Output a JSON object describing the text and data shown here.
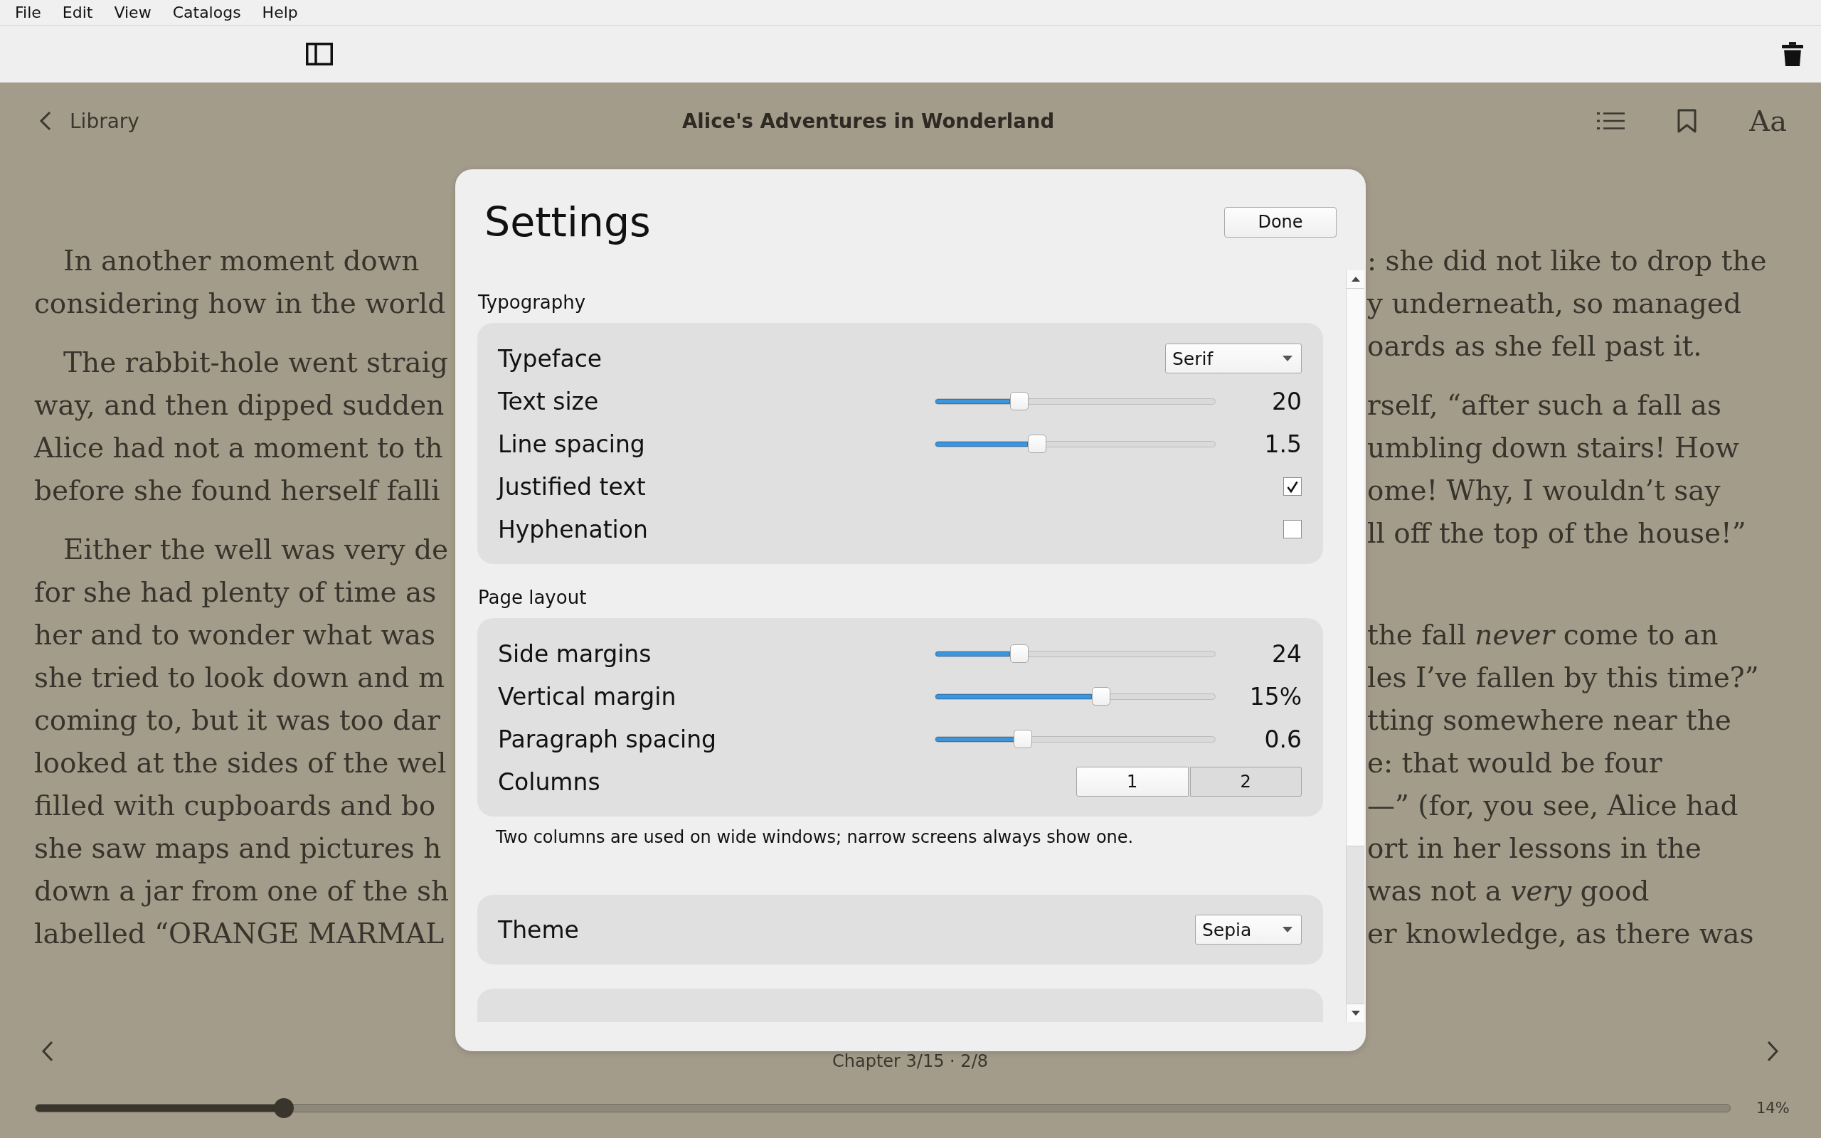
{
  "menu_bar": {
    "items": [
      "File",
      "Edit",
      "View",
      "Catalogs",
      "Help"
    ]
  },
  "reader": {
    "header": {
      "back_label": "Library",
      "title": "Alice's Adventures in Wonderland",
      "font_button": "Aa"
    },
    "page": {
      "columns": [
        {
          "paragraphs": [
            {
              "first_line_indent": true,
              "lines": [
                "In another moment down",
                "considering how in the world"
              ]
            },
            {
              "first_line_indent": true,
              "lines": [
                "The rabbit-hole went straig",
                "way, and then dipped sudden",
                "Alice had not a moment to th",
                "before she found herself falli"
              ]
            },
            {
              "first_line_indent": true,
              "lines": [
                "Either the well was very de",
                "for she had plenty of time as",
                "her and to wonder what was",
                "she tried to look down and m",
                "coming to, but it was too dar",
                "looked at the sides of the wel",
                "filled with cupboards and bo",
                "she saw maps and pictures h",
                "down a jar from one of the sh",
                "labelled “ORANGE MARMAL"
              ]
            }
          ]
        },
        {
          "paragraphs": [
            {
              "first_line_indent": false,
              "lines": [
                ": she did not like to drop the",
                "y underneath, so managed",
                "oards as she fell past it."
              ]
            },
            {
              "first_line_indent": false,
              "lines": [
                "rself, “after such a fall as",
                "umbling down stairs! How",
                "ome! Why, I wouldn’t say",
                "ll off the top of the house!”"
              ]
            },
            {
              "first_line_indent": false,
              "lines": [
                "the fall *never* come to an",
                "les I’ve fallen by this time?”",
                "tting somewhere near the",
                "e: that would be four",
                "—” (for, you see, Alice had",
                "ort in her lessons in the",
                "was not a *very* good",
                "er knowledge, as there was"
              ]
            }
          ]
        }
      ]
    },
    "footer": {
      "position": "Chapter 3/15 · 2/8",
      "progress": {
        "level": 0.147
      },
      "percent": "14%"
    }
  },
  "settings": {
    "title": "Settings",
    "done_label": "Done",
    "sections": [
      {
        "label": "Typography",
        "rows": [
          {
            "kind": "dropdown",
            "label": "Typeface",
            "value": "Serif"
          },
          {
            "kind": "slider",
            "label": "Text size",
            "level": 0.3,
            "reading": "20"
          },
          {
            "kind": "slider",
            "label": "Line spacing",
            "level": 0.365,
            "reading": "1.5"
          },
          {
            "kind": "checkbox",
            "label": "Justified text",
            "checked": true
          },
          {
            "kind": "checkbox",
            "label": "Hyphenation",
            "checked": false
          }
        ]
      },
      {
        "label": "Page layout",
        "rows": [
          {
            "kind": "slider",
            "label": "Side margins",
            "level": 0.3,
            "reading": "24"
          },
          {
            "kind": "slider",
            "label": "Vertical margin",
            "level": 0.592,
            "reading": "15%"
          },
          {
            "kind": "slider",
            "label": "Paragraph spacing",
            "level": 0.315,
            "reading": "0.6"
          },
          {
            "kind": "segmented",
            "label": "Columns",
            "options": [
              {
                "label": "1",
                "selected": false
              },
              {
                "label": "2",
                "selected": true
              }
            ]
          }
        ],
        "note": "Two columns are used on wide windows; narrow screens always show one."
      },
      {
        "rows": [
          {
            "kind": "dropdown",
            "label": "Theme",
            "value": "Sepia"
          }
        ]
      }
    ],
    "cut_off_card": true
  }
}
